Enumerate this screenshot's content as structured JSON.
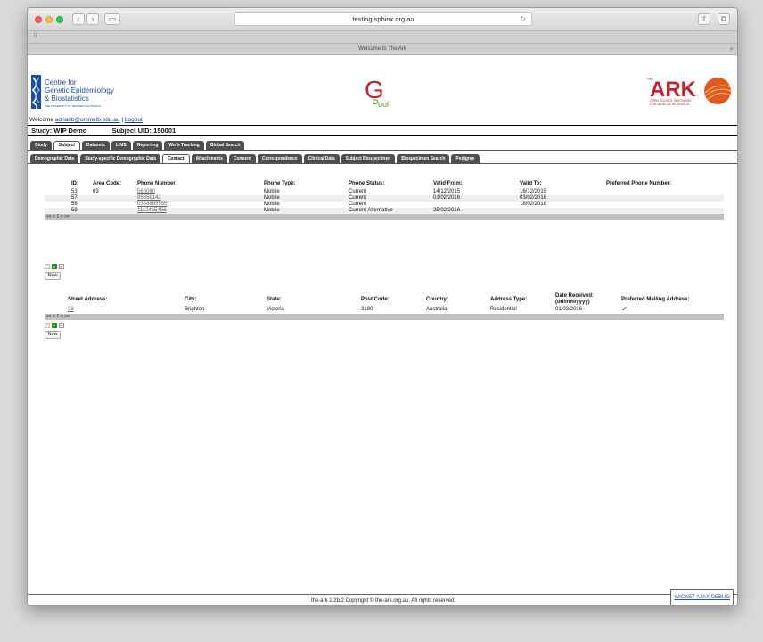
{
  "browser": {
    "url": "testing.sphinx.org.au",
    "tab_title": "Welcome to The Ark"
  },
  "logos": {
    "cge": {
      "line1": "Centre for",
      "line2": "Genetic Epidemiology",
      "line3": "& Biostatistics",
      "sub": "THE UNIVERSITY OF WESTERN AUSTRALIA"
    },
    "gpool": {
      "g": "G",
      "p": "P",
      "ool": "ool"
    },
    "ark": {
      "the": "THE",
      "name": "ARK",
      "tag1": "OPEN SOURCE SOFTWARE",
      "tag2": "FOR MEDICAL RESEARCH"
    }
  },
  "session": {
    "welcome": "Welcome",
    "user": "adrianb@unimelb.edu.au",
    "separator": "|",
    "logout": "Logout"
  },
  "study": {
    "study_label": "Study: WIP Demo",
    "subject_label": "Subject UID: 150001"
  },
  "main_tabs": [
    "Study",
    "Subject",
    "Datasets",
    "LIMS",
    "Reporting",
    "Work Tracking",
    "Global Search"
  ],
  "sub_tabs": [
    "Demographic Data",
    "Study-specific Demographic Data",
    "Contact",
    "Attachments",
    "Consent",
    "Correspondence",
    "Clinical Data",
    "Subject Biospecimen",
    "Biospecimen Search",
    "Pedigree"
  ],
  "phones": {
    "headers": [
      "ID:",
      "Area Code:",
      "Phone Number:",
      "Phone Type:",
      "Phone Status:",
      "Valid From:",
      "Valid To:",
      "Preferred Phone Number:"
    ],
    "rows": [
      [
        "53",
        "03",
        "563060",
        "Mobile",
        "Current",
        "14/12/2015",
        "16/12/2015",
        ""
      ],
      [
        "57",
        "",
        "95558142",
        "Mobile",
        "Current",
        "01/02/2016",
        "03/02/2016",
        ""
      ],
      [
        "58",
        "",
        "0388885555",
        "Mobile",
        "Current",
        "",
        "18/02/2016",
        ""
      ],
      [
        "59",
        "",
        "1112455456",
        "Mobile",
        "Current Alternative",
        "25/02/2016",
        "",
        ""
      ]
    ],
    "pager": "<< < 1 > >>"
  },
  "addresses": {
    "headers": [
      "Street Address:",
      "City:",
      "State:",
      "Post Code:",
      "Country:",
      "Address Type:",
      "Date Received: (dd/mm/yyyy)",
      "Preferred Mailing Address:"
    ],
    "rows": [
      [
        "23",
        "Brighton",
        "Victoria",
        "3180",
        "Australia",
        "Residential",
        "01/03/2016",
        "✔"
      ]
    ],
    "pager": "<< < 1 > >>"
  },
  "buttons": {
    "new": "New"
  },
  "export_icons": [
    "csv-icon",
    "excel-icon",
    "pdf-icon"
  ],
  "footer": {
    "copyright": "the-ark 1.2b.2 Copyright © the-ark.org.au. All rights reserved.",
    "debug": "WICKET AJAX DEBUG"
  },
  "colors": {
    "tab_bg": "#505050",
    "ark_red": "#c0232b",
    "link": "#1a3c8a",
    "check": "#3ba03b"
  }
}
